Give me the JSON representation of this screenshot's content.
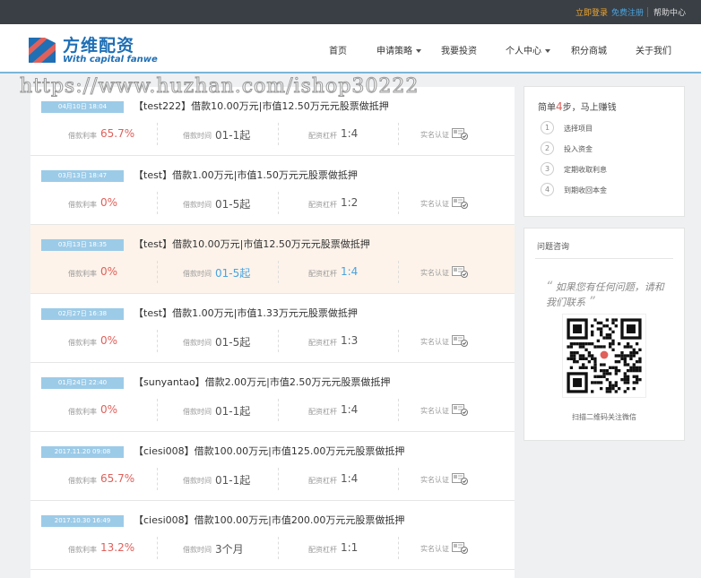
{
  "topbar": {
    "login": "立即登录",
    "register": "免费注册",
    "help": "帮助中心"
  },
  "header": {
    "logo_cn": "方维配资",
    "logo_en": "With capital fanwe",
    "nav": [
      {
        "label": "首页"
      },
      {
        "label": "申请策略"
      },
      {
        "label": "我要投资"
      },
      {
        "label": "个人中心"
      },
      {
        "label": "积分商城"
      },
      {
        "label": "关于我们"
      }
    ]
  },
  "watermark": "https://www.huzhan.com/ishop30222",
  "labels": {
    "rate": "借款利率",
    "term": "借款时间",
    "leverage": "配资杠杆",
    "verify": "实名认证"
  },
  "items": [
    {
      "date": "04月10日 18:04",
      "title": "【test222】借款10.00万元|市值12.50万元元股票做抵押",
      "rate": "65.7%",
      "term": "01-1起",
      "leverage": "1:4"
    },
    {
      "date": "03月13日 18:47",
      "title": "【test】借款1.00万元|市值1.50万元元股票做抵押",
      "rate": "0%",
      "term": "01-5起",
      "leverage": "1:2"
    },
    {
      "date": "03月13日 18:35",
      "title": "【test】借款10.00万元|市值12.50万元元股票做抵押",
      "rate": "0%",
      "term": "01-5起",
      "leverage": "1:4"
    },
    {
      "date": "02月27日 16:38",
      "title": "【test】借款1.00万元|市值1.33万元元股票做抵押",
      "rate": "0%",
      "term": "01-5起",
      "leverage": "1:3"
    },
    {
      "date": "01月24日 22:40",
      "title": "【sunyantao】借款2.00万元|市值2.50万元元股票做抵押",
      "rate": "0%",
      "term": "01-1起",
      "leverage": "1:4"
    },
    {
      "date": "2017.11.20 09:08",
      "title": "【ciesi008】借款100.00万元|市值125.00万元元股票做抵押",
      "rate": "65.7%",
      "term": "01-1起",
      "leverage": "1:4"
    },
    {
      "date": "2017.10.30 16:49",
      "title": "【ciesi008】借款100.00万元|市值200.00万元元股票做抵押",
      "rate": "13.2%",
      "term": "3个月",
      "leverage": "1:1"
    }
  ],
  "steps": {
    "title_pre": "简单",
    "title_num": "4",
    "title_post": "步，马上赚钱",
    "items": [
      {
        "n": "1",
        "label": "选择项目"
      },
      {
        "n": "2",
        "label": "投入资金"
      },
      {
        "n": "3",
        "label": "定期收取利息"
      },
      {
        "n": "4",
        "label": "到期收回本金"
      }
    ]
  },
  "qa": {
    "title": "问题咨询",
    "quote_open": "“",
    "quote_text": "如果您有任何问题，请和我们联系",
    "quote_close": "”",
    "caption": "扫描二维码关注微信"
  },
  "colors": {
    "accent_blue": "#1f6fb5",
    "rate_red": "#e0605a",
    "tag_blue": "#9ccbe8",
    "link_blue": "#4aa3df",
    "login_orange": "#f0a52a"
  }
}
